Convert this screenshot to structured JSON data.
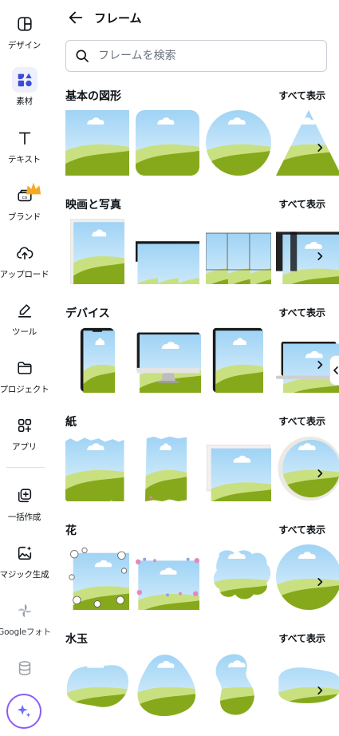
{
  "sidebar": {
    "items": [
      {
        "label": "デザイン",
        "icon": "layout-icon"
      },
      {
        "label": "素材",
        "icon": "elements-icon"
      },
      {
        "label": "テキスト",
        "icon": "text-icon"
      },
      {
        "label": "ブランド",
        "icon": "brand-icon"
      },
      {
        "label": "アップロード",
        "icon": "upload-icon"
      },
      {
        "label": "ツール",
        "icon": "draw-icon"
      },
      {
        "label": "プロジェクト",
        "icon": "folder-icon"
      },
      {
        "label": "アプリ",
        "icon": "apps-icon"
      },
      {
        "label": "一括作成",
        "icon": "bulk-create-icon"
      },
      {
        "label": "マジック生成",
        "icon": "magic-media-icon"
      },
      {
        "label": "Googleフォト",
        "icon": "google-photos-icon"
      }
    ],
    "accent": "#8b5cf6"
  },
  "panel": {
    "title": "フレーム",
    "search_placeholder": "フレームを検索",
    "see_all": "すべて表示",
    "sections": [
      {
        "title": "基本の図形"
      },
      {
        "title": "映画と写真"
      },
      {
        "title": "デバイス"
      },
      {
        "title": "紙"
      },
      {
        "title": "花"
      },
      {
        "title": "水玉"
      }
    ]
  }
}
